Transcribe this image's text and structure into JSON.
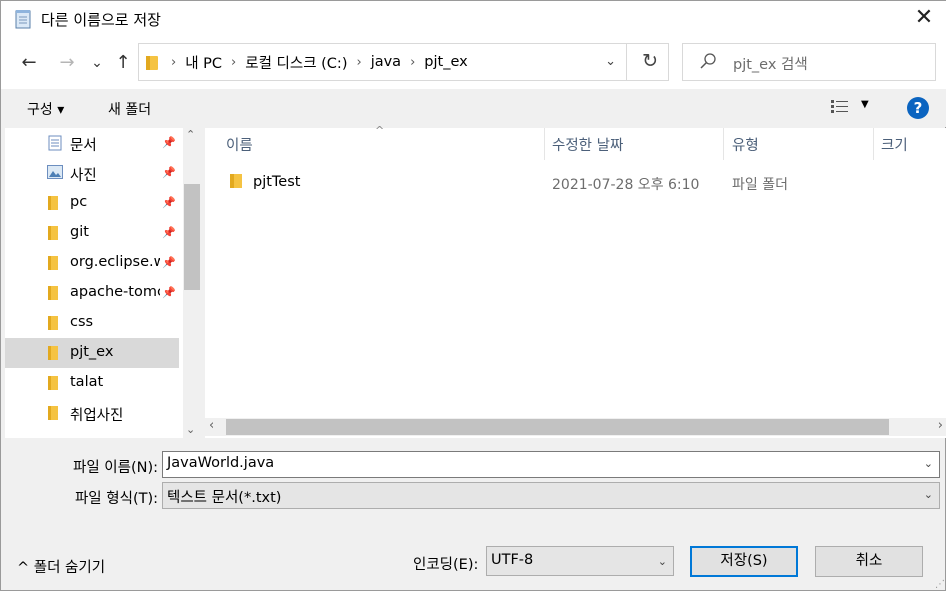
{
  "window": {
    "title": "다른 이름으로 저장",
    "close_glyph": "✕"
  },
  "nav": {
    "back_glyph": "←",
    "forward_glyph": "→",
    "recent_glyph": "⌄",
    "up_glyph": "↑",
    "breadcrumbs": [
      "내 PC",
      "로컬 디스크 (C:)",
      "java",
      "pjt_ex"
    ],
    "breadcrumb_sep": "›",
    "refresh_glyph": "↻",
    "search_placeholder": "pjt_ex 검색"
  },
  "toolbar": {
    "organize_label": "구성 ▾",
    "new_folder_label": "새 폴더",
    "view_dropdown_glyph": "▼",
    "help_label": "?"
  },
  "sidebar": {
    "items": [
      {
        "label": "문서",
        "icon": "documents-icon",
        "pinned": true
      },
      {
        "label": "사진",
        "icon": "pictures-icon",
        "pinned": true
      },
      {
        "label": "pc",
        "icon": "folder-icon",
        "pinned": true
      },
      {
        "label": "git",
        "icon": "folder-icon",
        "pinned": true
      },
      {
        "label": "org.eclipse.ws",
        "icon": "folder-icon",
        "pinned": true
      },
      {
        "label": "apache-tomc",
        "icon": "folder-icon",
        "pinned": true
      },
      {
        "label": "css",
        "icon": "folder-icon",
        "pinned": false
      },
      {
        "label": "pjt_ex",
        "icon": "folder-icon",
        "pinned": false,
        "selected": true
      },
      {
        "label": "talat",
        "icon": "folder-icon",
        "pinned": false
      },
      {
        "label": "취업사진",
        "icon": "folder-icon",
        "pinned": false
      }
    ],
    "pin_glyph": "📌",
    "scroll_up": "⌃",
    "scroll_down": "⌄"
  },
  "file_list": {
    "columns": [
      "이름",
      "수정한 날짜",
      "유형",
      "크기"
    ],
    "sort_glyph": "^",
    "rows": [
      {
        "name": "pjtTest",
        "date": "2021-07-28 오후 6:10",
        "type": "파일 폴더"
      }
    ],
    "scroll_left": "‹",
    "scroll_right": "›"
  },
  "form": {
    "filename_label": "파일 이름(N):",
    "filename_value": "JavaWorld.java",
    "filetype_label": "파일 형식(T):",
    "filetype_value": "텍스트 문서(*.txt)",
    "dropdown_glyph": "⌄"
  },
  "footer": {
    "collapse_label": "^ 폴더 숨기기",
    "encoding_label": "인코딩(E):",
    "encoding_value": "UTF-8",
    "save_label": "저장(S)",
    "cancel_label": "취소"
  },
  "colors": {
    "accent": "#0078d7",
    "folder": "#f5c342",
    "help": "#0b64c0",
    "selection": "#d9d9d9"
  }
}
